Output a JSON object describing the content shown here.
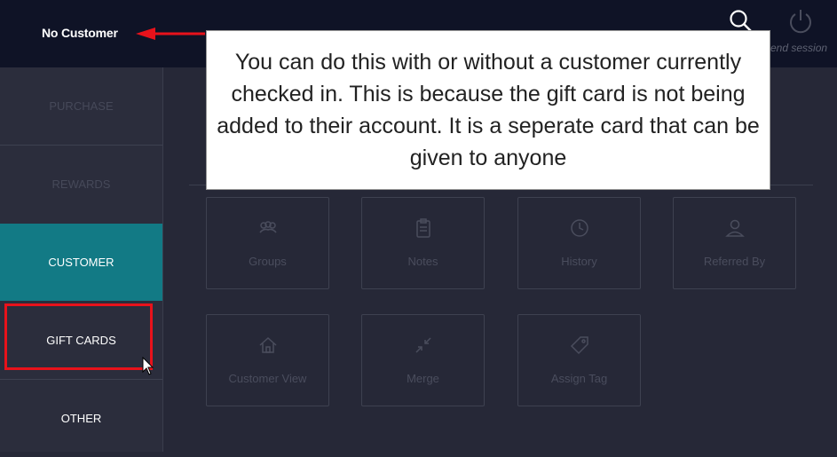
{
  "header": {
    "customer_label": "No Customer",
    "end_session_label": "end session"
  },
  "sidebar": {
    "items": [
      {
        "label": "PURCHASE"
      },
      {
        "label": "REWARDS"
      },
      {
        "label": "CUSTOMER"
      },
      {
        "label": "GIFT CARDS"
      },
      {
        "label": "OTHER"
      }
    ]
  },
  "tiles": [
    {
      "label": "Groups",
      "icon": "groups-icon"
    },
    {
      "label": "Notes",
      "icon": "clipboard-icon"
    },
    {
      "label": "History",
      "icon": "clock-icon"
    },
    {
      "label": "Referred By",
      "icon": "person-icon"
    },
    {
      "label": "Customer View",
      "icon": "home-icon"
    },
    {
      "label": "Merge",
      "icon": "merge-icon"
    },
    {
      "label": "Assign Tag",
      "icon": "tag-icon"
    }
  ],
  "callout": {
    "text": "You can do this with or without a customer currently checked in. This is because the gift card is not being added to their account. It is a seperate card that can be given to anyone"
  },
  "colors": {
    "topbar": "#0f1326",
    "active_nav": "#127a85",
    "annotation_red": "#e8121b"
  }
}
